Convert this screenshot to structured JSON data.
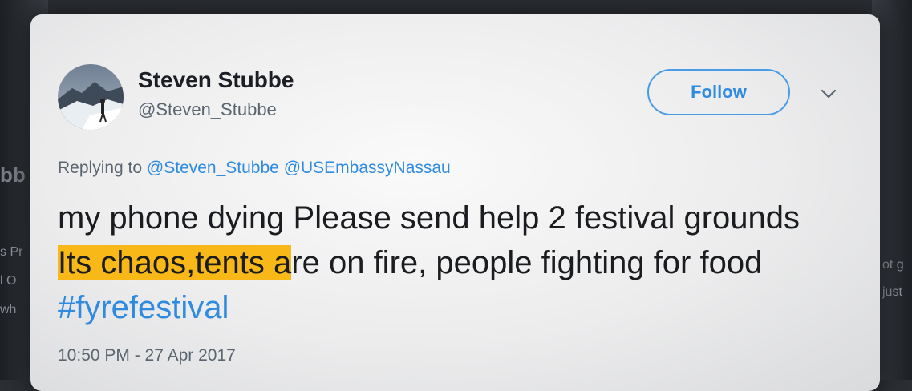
{
  "background": {
    "left_fragments": [
      "bb",
      "s Pr",
      "l O",
      "wh"
    ],
    "right_fragments": [
      "ot g",
      "just"
    ]
  },
  "tweet": {
    "author_name": "Steven Stubbe",
    "author_handle": "@Steven_Stubbe",
    "follow_label": "Follow",
    "replying_prefix": "Replying to",
    "reply_mentions": [
      "@Steven_Stubbe",
      "@USEmbassyNassau"
    ],
    "text_part1": "my phone dying Please send help 2 festival grounds ",
    "text_highlight": "Its chaos,tents a",
    "text_part2": "re on fire, people fighting for food ",
    "hashtag": "#fyrefestival",
    "timestamp": "10:50 PM - 27 Apr 2017"
  },
  "colors": {
    "link": "#2f8be0",
    "highlight": "#f7b818",
    "text": "#1a1c1f",
    "muted": "#5b6570"
  },
  "icons": {
    "more": "chevron-down-icon"
  }
}
